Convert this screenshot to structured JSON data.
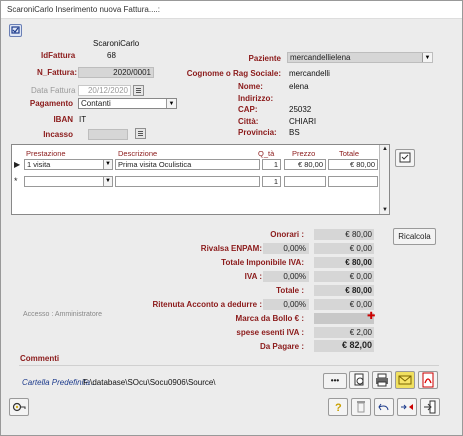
{
  "title": "ScaroniCarlo  Inserimento nuova Fattura....:",
  "header": {
    "medico": "ScaroniCarlo",
    "id_label": "IdFattura",
    "id_value": "68",
    "num_label": "N_Fattura:",
    "num_value": "2020/0001",
    "data_label": "Data Fattura",
    "data_value": "20/12/2020",
    "pagamento_label": "Pagamento",
    "pagamento_value": "Contanti",
    "iban_label": "IBAN",
    "iban_value": "IT",
    "incasso_label": "Incasso"
  },
  "paziente": {
    "label": "Paziente",
    "value": "mercandellielena",
    "cognome_label": "Cognome o Rag Sociale:",
    "cognome_value": "mercandelli",
    "nome_label": "Nome:",
    "nome_value": "elena",
    "indirizzo_label": "Indirizzo:",
    "indirizzo_value": "",
    "cap_label": "CAP:",
    "cap_value": "25032",
    "citta_label": "Città:",
    "citta_value": "CHIARI",
    "provincia_label": "Provincia:",
    "provincia_value": "BS"
  },
  "grid": {
    "headers": [
      "Prestazione",
      "Descrizione",
      "Q_tà",
      "Prezzo",
      "Totale"
    ],
    "rows": [
      {
        "marker": "▶",
        "prestazione": "1 visita",
        "descrizione": "Prima visita Oculistica",
        "qta": "1",
        "prezzo": "€ 80,00",
        "totale": "€ 80,00"
      },
      {
        "marker": "*",
        "prestazione": "",
        "descrizione": "",
        "qta": "1",
        "prezzo": "",
        "totale": ""
      }
    ]
  },
  "totals": {
    "onorari_label": "Onorari :",
    "onorari_value": "€ 80,00",
    "enpam_label": "Rivalsa ENPAM:",
    "enpam_pct": "0,00%",
    "enpam_value": "€ 0,00",
    "imponibile_label": "Totale Imponibile IVA:",
    "imponibile_value": "€ 80,00",
    "iva_label": "IVA :",
    "iva_pct": "0,00%",
    "iva_value": "€ 0,00",
    "totale_label": "Totale :",
    "totale_value": "€ 80,00",
    "ritenuta_label": "Ritenuta Acconto a dedurre :",
    "ritenuta_pct": "0,00%",
    "ritenuta_value": "€ 0,00",
    "bollo_label": "Marca da Bollo € :",
    "bollo_value": "",
    "spese_label": "spese esenti IVA :",
    "spese_value": "€ 2,00",
    "pagare_label": "Da Pagare :",
    "pagare_value": "€ 82,00"
  },
  "ricalcola_label": "Ricalcola",
  "accesso": "Accesso : Amministratore",
  "commenti_label": "Commenti",
  "cartella_label": "Cartella Predefinita :",
  "cartella_value": "F:\\database\\SOcu\\Socu0906\\Source\\",
  "more_label": "•••"
}
